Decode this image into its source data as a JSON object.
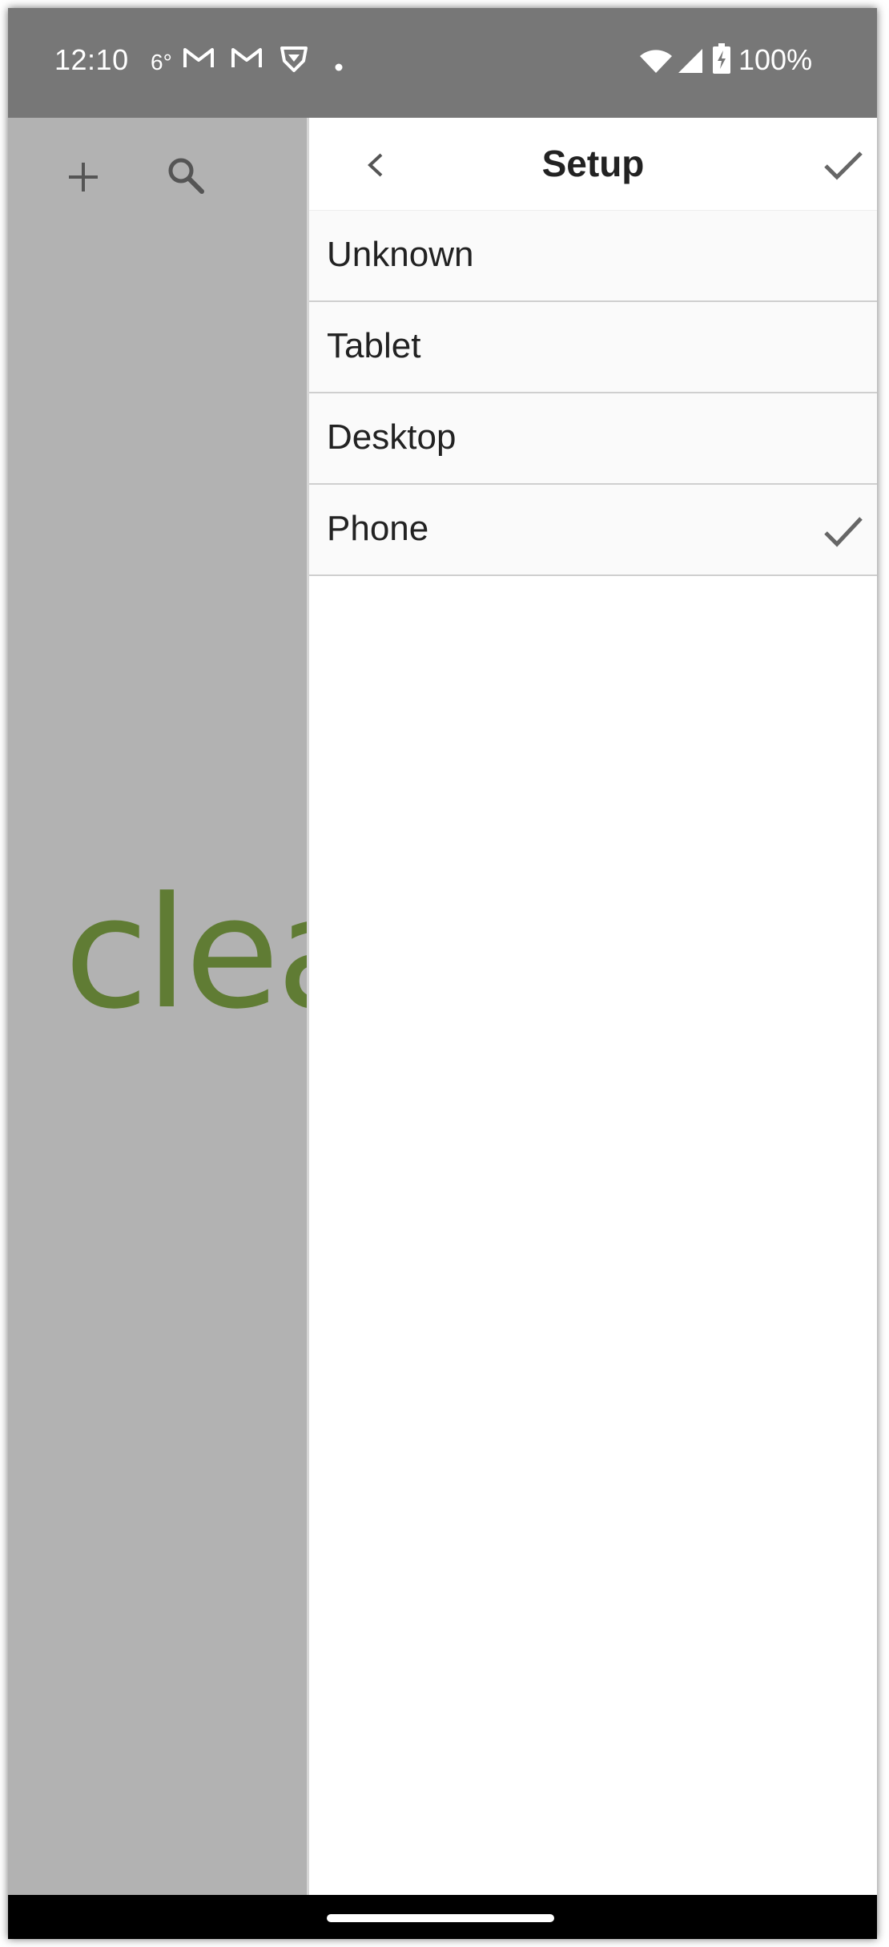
{
  "status_bar": {
    "time": "12:10",
    "weather_temp": "6°",
    "battery_percent": "100%"
  },
  "background_app": {
    "visible_text": "clea",
    "accent_color": "#607c34"
  },
  "panel": {
    "title": "Setup",
    "options": [
      {
        "label": "Unknown",
        "selected": false
      },
      {
        "label": "Tablet",
        "selected": false
      },
      {
        "label": "Desktop",
        "selected": false
      },
      {
        "label": "Phone",
        "selected": true
      }
    ]
  }
}
